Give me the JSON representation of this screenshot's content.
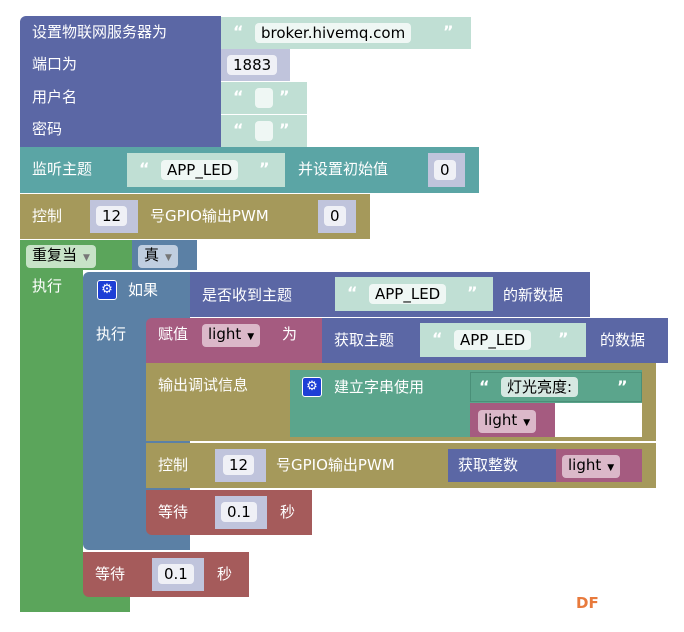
{
  "mqtt": {
    "label_server": "设置物联网服务器为",
    "server": "broker.hivemq.com",
    "label_port": "端口为",
    "port": "1883",
    "label_user": "用户名",
    "user": "",
    "label_pass": "密码",
    "pass": ""
  },
  "subscribe": {
    "label": "监听主题",
    "topic": "APP_LED",
    "label_init": "并设置初始值",
    "init": "0"
  },
  "pwm1": {
    "label": "控制",
    "pin": "12",
    "label_mid": "号GPIO输出PWM",
    "value": "0"
  },
  "loop": {
    "mode": "重复当",
    "cond": "真",
    "label_do": "执行"
  },
  "if": {
    "label": "如果",
    "label_do": "执行",
    "cond_label": "是否收到主题",
    "topic": "APP_LED",
    "cond_suffix": "的新数据"
  },
  "assign": {
    "label": "赋值",
    "var": "light",
    "label_as": "为",
    "get_label": "获取主题",
    "topic": "APP_LED",
    "get_suffix": "的数据"
  },
  "debug": {
    "label": "输出调试信息",
    "join_label": "建立字串使用",
    "text": "灯光亮度:",
    "var": "light"
  },
  "pwm2": {
    "label": "控制",
    "pin": "12",
    "label_mid": "号GPIO输出PWM",
    "int_label": "获取整数",
    "var": "light"
  },
  "wait1": {
    "label": "等待",
    "value": "0.1",
    "unit": "秒"
  },
  "wait2": {
    "label": "等待",
    "value": "0.1",
    "unit": "秒"
  },
  "quote_open": "“",
  "quote_close": "”",
  "watermark": "DF"
}
